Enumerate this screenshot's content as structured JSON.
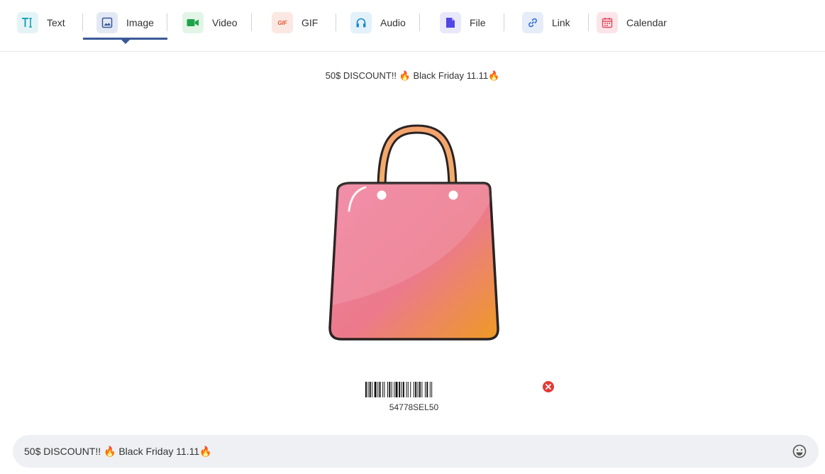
{
  "tabs": [
    {
      "id": "text",
      "label": "Text",
      "icon": "text-icon"
    },
    {
      "id": "image",
      "label": "Image",
      "icon": "image-icon",
      "active": true
    },
    {
      "id": "video",
      "label": "Video",
      "icon": "video-icon"
    },
    {
      "id": "gif",
      "label": "GIF",
      "icon": "gif-icon",
      "icon_text": "GIF"
    },
    {
      "id": "audio",
      "label": "Audio",
      "icon": "headphones-icon"
    },
    {
      "id": "file",
      "label": "File",
      "icon": "file-icon"
    },
    {
      "id": "link",
      "label": "Link",
      "icon": "link-icon"
    },
    {
      "id": "calendar",
      "label": "Calendar",
      "icon": "calendar-icon"
    }
  ],
  "preview": {
    "caption": "50$ DISCOUNT!! 🔥 Black Friday 11.11🔥",
    "image": "shopping-bag-image",
    "barcode_number": "54778SEL50",
    "remove_icon": "close-circle-icon"
  },
  "message": {
    "text": "50$ DISCOUNT!! 🔥 Black Friday 11.11🔥",
    "emoji_icon": "smiley-icon"
  },
  "colors": {
    "active_tab": "#3b5998",
    "remove_red": "#e53935",
    "input_bg": "#eef0f3"
  }
}
